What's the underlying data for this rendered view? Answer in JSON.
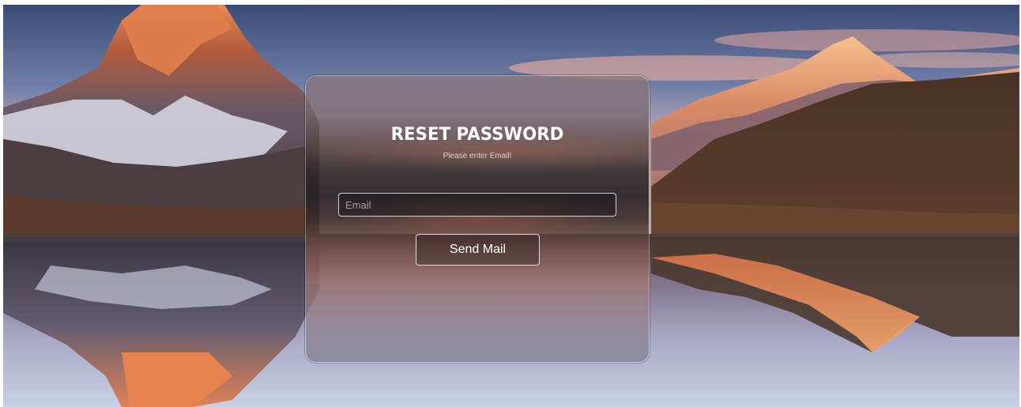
{
  "background": {
    "alt": "Mountain lake landscape at sunset"
  },
  "form": {
    "title": "RESET PASSWORD",
    "subtitle": "Please enter Email!",
    "email_placeholder": "Email",
    "email_value": "",
    "submit_label": "Send Mail"
  },
  "colors": {
    "text": "#ffffff",
    "input_border": "#ebebf0",
    "card_border": "#8a7a7e"
  }
}
